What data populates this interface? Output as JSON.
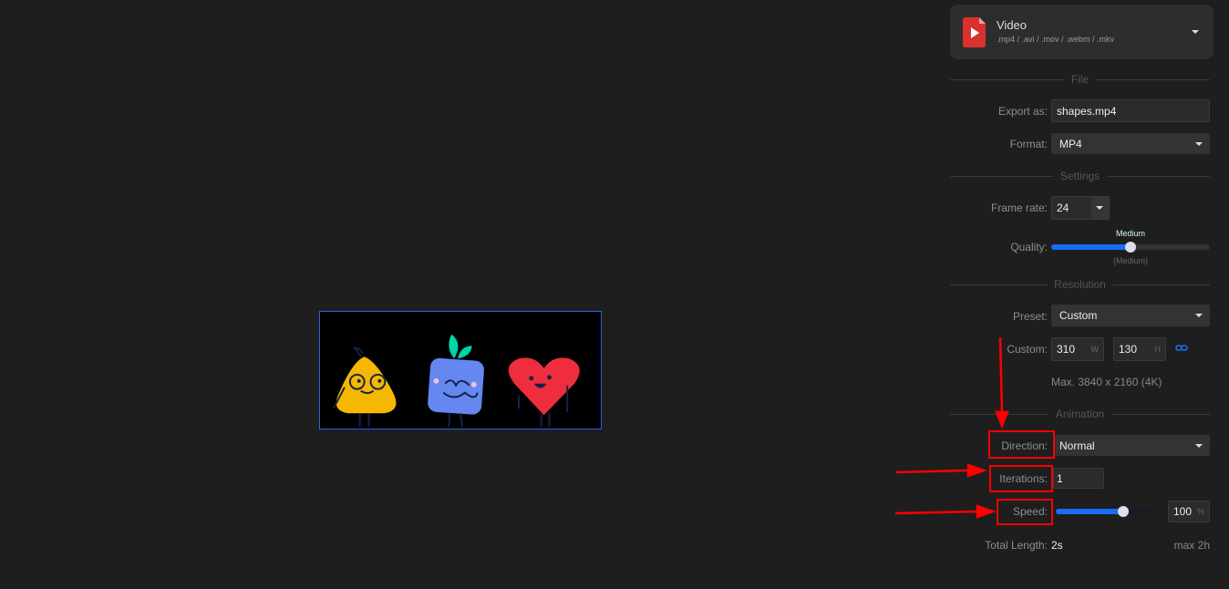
{
  "format_card": {
    "title": "Video",
    "subtitle": ".mp4 / .avi / .mov / .webm / .mkv",
    "icon": "video-file-icon"
  },
  "sections": {
    "file": "File",
    "settings": "Settings",
    "resolution": "Resolution",
    "animation": "Animation"
  },
  "file": {
    "export_label": "Export as:",
    "export_value": "shapes.mp4",
    "format_label": "Format:",
    "format_value": "MP4"
  },
  "settings": {
    "frame_rate_label": "Frame rate:",
    "frame_rate_value": "24",
    "quality_label": "Quality:",
    "quality_value_top": "Medium",
    "quality_value_bottom": "(Medium)",
    "quality_level_percent": 50
  },
  "resolution": {
    "preset_label": "Preset:",
    "preset_value": "Custom",
    "custom_label": "Custom:",
    "width": "310",
    "width_unit": "W",
    "height": "130",
    "height_unit": "H",
    "max_text": "Max. 3840 x 2160 (4K)"
  },
  "animation": {
    "direction_label": "Direction:",
    "direction_value": "Normal",
    "iterations_label": "Iterations:",
    "iterations_value": "1",
    "speed_label": "Speed:",
    "speed_value": "100",
    "speed_unit": "%",
    "speed_slider_percent": 68,
    "total_length_label": "Total Length:",
    "total_length_value": "2s",
    "max_text": "max 2h"
  },
  "colors": {
    "accent": "#1a6cf5",
    "annotation": "#ff0000",
    "background": "#1e1e1e"
  }
}
